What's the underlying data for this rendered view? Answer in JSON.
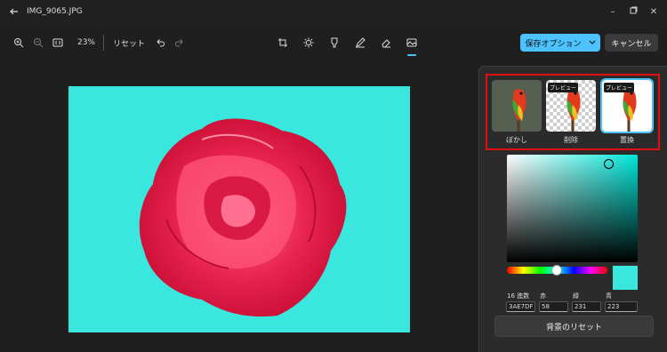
{
  "window": {
    "title": "IMG_9065.JPG"
  },
  "toolbar": {
    "zoom_level": "23%",
    "reset_label": "リセット"
  },
  "actions": {
    "save_label": "保存オプション",
    "cancel_label": "キャンセル"
  },
  "background_options": [
    {
      "label": "ぼかし",
      "badge": ""
    },
    {
      "label": "削除",
      "badge": "プレビュー"
    },
    {
      "label": "置換",
      "badge": "プレビュー",
      "selected": true
    }
  ],
  "color_picker": {
    "selected_color": "#3ae7df",
    "fields": [
      {
        "label": "16 進数",
        "value": "3AE7DF"
      },
      {
        "label": "赤",
        "value": "58"
      },
      {
        "label": "緑",
        "value": "231"
      },
      {
        "label": "青",
        "value": "223"
      }
    ]
  },
  "reset_background_label": "背景のリセット",
  "colors": {
    "accent": "#4cc2ff",
    "highlight_box": "#e01010",
    "canvas_bg": "#3ae7df"
  }
}
